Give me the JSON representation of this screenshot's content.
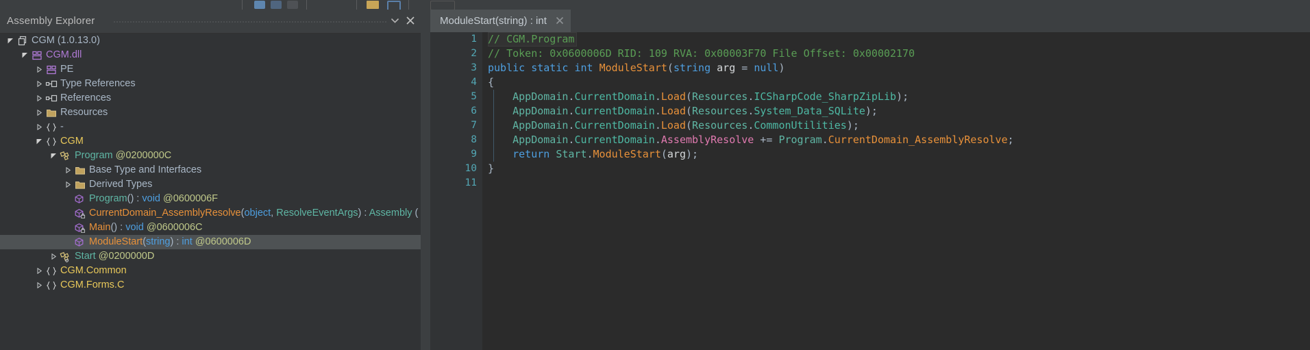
{
  "toolbar": {
    "separators": [
      353,
      447,
      555,
      640,
      700,
      760,
      820,
      900,
      1000
    ]
  },
  "panel": {
    "title": "Assembly Explorer",
    "chevron_icon": "chevron-down-icon",
    "close_icon": "close-icon"
  },
  "tree": [
    {
      "depth": 0,
      "twisty": "open",
      "icon": "assemblies-icon",
      "selected": false,
      "parts": [
        {
          "t": "CGM (1.0.13.0)",
          "c": "c-grayblue"
        }
      ]
    },
    {
      "depth": 1,
      "twisty": "open",
      "icon": "module-icon",
      "selected": false,
      "parts": [
        {
          "t": "CGM.dll",
          "c": "c-purpleTxt"
        }
      ]
    },
    {
      "depth": 2,
      "twisty": "closed",
      "icon": "module-icon",
      "selected": false,
      "parts": [
        {
          "t": "PE",
          "c": "c-grayblue"
        }
      ]
    },
    {
      "depth": 2,
      "twisty": "closed",
      "icon": "reference-icon",
      "selected": false,
      "parts": [
        {
          "t": "Type References",
          "c": "c-grayblue"
        }
      ]
    },
    {
      "depth": 2,
      "twisty": "closed",
      "icon": "reference-icon",
      "selected": false,
      "parts": [
        {
          "t": "References",
          "c": "c-grayblue"
        }
      ]
    },
    {
      "depth": 2,
      "twisty": "closed",
      "icon": "folder-icon",
      "selected": false,
      "parts": [
        {
          "t": "Resources",
          "c": "c-grayblue"
        }
      ]
    },
    {
      "depth": 2,
      "twisty": "closed",
      "icon": "namespace-icon",
      "selected": false,
      "parts": [
        {
          "t": "-",
          "c": "c-grayblue"
        }
      ]
    },
    {
      "depth": 2,
      "twisty": "open",
      "icon": "namespace-icon",
      "selected": false,
      "parts": [
        {
          "t": "CGM",
          "c": "c-yellow"
        }
      ]
    },
    {
      "depth": 3,
      "twisty": "open",
      "icon": "class-icon",
      "selected": false,
      "parts": [
        {
          "t": "Program",
          "c": "c-teal"
        },
        {
          "t": " ",
          "c": "c-grayblue"
        },
        {
          "t": "@0200000C",
          "c": "c-olive"
        }
      ]
    },
    {
      "depth": 4,
      "twisty": "closed",
      "icon": "folder-icon",
      "selected": false,
      "parts": [
        {
          "t": "Base Type and Interfaces",
          "c": "c-grayblue"
        }
      ]
    },
    {
      "depth": 4,
      "twisty": "closed",
      "icon": "folder-icon",
      "selected": false,
      "parts": [
        {
          "t": "Derived Types",
          "c": "c-grayblue"
        }
      ]
    },
    {
      "depth": 4,
      "twisty": "none",
      "icon": "method-icon",
      "selected": false,
      "parts": [
        {
          "t": "Program",
          "c": "c-teal"
        },
        {
          "t": "()",
          "c": "c-grayblue"
        },
        {
          "t": " : ",
          "c": "c-grayblue"
        },
        {
          "t": "void",
          "c": "c-blue"
        },
        {
          "t": " ",
          "c": "c-grayblue"
        },
        {
          "t": "@0600006F",
          "c": "c-olive"
        }
      ]
    },
    {
      "depth": 4,
      "twisty": "none",
      "icon": "method-private-icon",
      "selected": false,
      "parts": [
        {
          "t": "CurrentDomain_AssemblyResolve",
          "c": "c-orange"
        },
        {
          "t": "(",
          "c": "c-grayblue"
        },
        {
          "t": "object",
          "c": "c-blue"
        },
        {
          "t": ", ",
          "c": "c-grayblue"
        },
        {
          "t": "ResolveEventArgs",
          "c": "c-teal"
        },
        {
          "t": ") : ",
          "c": "c-grayblue"
        },
        {
          "t": "Assembly",
          "c": "c-teal"
        },
        {
          "t": " (",
          "c": "c-grayblue"
        }
      ]
    },
    {
      "depth": 4,
      "twisty": "none",
      "icon": "method-private-icon",
      "selected": false,
      "parts": [
        {
          "t": "Main",
          "c": "c-orange"
        },
        {
          "t": "()",
          "c": "c-grayblue"
        },
        {
          "t": " : ",
          "c": "c-grayblue"
        },
        {
          "t": "void",
          "c": "c-blue"
        },
        {
          "t": " ",
          "c": "c-grayblue"
        },
        {
          "t": "@0600006C",
          "c": "c-olive"
        }
      ]
    },
    {
      "depth": 4,
      "twisty": "none",
      "icon": "method-icon",
      "selected": true,
      "parts": [
        {
          "t": "ModuleStart",
          "c": "c-orange"
        },
        {
          "t": "(",
          "c": "c-grayblue"
        },
        {
          "t": "string",
          "c": "c-blue"
        },
        {
          "t": ") : ",
          "c": "c-grayblue"
        },
        {
          "t": "int",
          "c": "c-blue"
        },
        {
          "t": " ",
          "c": "c-grayblue"
        },
        {
          "t": "@0600006D",
          "c": "c-olive"
        }
      ]
    },
    {
      "depth": 3,
      "twisty": "closed",
      "icon": "class-internal-icon",
      "selected": false,
      "parts": [
        {
          "t": "Start",
          "c": "c-teal"
        },
        {
          "t": " ",
          "c": "c-grayblue"
        },
        {
          "t": "@0200000D",
          "c": "c-olive"
        }
      ]
    },
    {
      "depth": 2,
      "twisty": "closed",
      "icon": "namespace-icon",
      "selected": false,
      "parts": [
        {
          "t": "CGM.Common",
          "c": "c-yellow"
        }
      ]
    },
    {
      "depth": 2,
      "twisty": "closed",
      "icon": "namespace-icon",
      "selected": false,
      "parts": [
        {
          "t": "CGM.Forms.C",
          "c": "c-yellow"
        }
      ]
    }
  ],
  "editor": {
    "tab": {
      "label": "ModuleStart(string) : int",
      "close_icon": "close-icon"
    },
    "lines": [
      {
        "n": "1",
        "current": true,
        "guide": false,
        "parts": [
          {
            "t": "// CGM.Program",
            "c": "c-green"
          }
        ]
      },
      {
        "n": "2",
        "current": false,
        "guide": false,
        "parts": [
          {
            "t": "// Token: 0x0600006D RID: 109 RVA: 0x00003F70 File Offset: 0x00002170",
            "c": "c-green"
          }
        ]
      },
      {
        "n": "3",
        "current": false,
        "guide": false,
        "parts": [
          {
            "t": "public",
            "c": "c-blue"
          },
          {
            "t": " ",
            "c": "c-grayblue"
          },
          {
            "t": "static",
            "c": "c-blue"
          },
          {
            "t": " ",
            "c": "c-grayblue"
          },
          {
            "t": "int",
            "c": "c-blue"
          },
          {
            "t": " ",
            "c": "c-grayblue"
          },
          {
            "t": "ModuleStart",
            "c": "c-orange"
          },
          {
            "t": "(",
            "c": "c-grayblue"
          },
          {
            "t": "string",
            "c": "c-blue"
          },
          {
            "t": " ",
            "c": "c-grayblue"
          },
          {
            "t": "arg",
            "c": "c-white"
          },
          {
            "t": " = ",
            "c": "c-grayblue"
          },
          {
            "t": "null",
            "c": "c-blue"
          },
          {
            "t": ")",
            "c": "c-grayblue"
          }
        ]
      },
      {
        "n": "4",
        "current": false,
        "guide": false,
        "parts": [
          {
            "t": "{",
            "c": "c-grayblue"
          }
        ]
      },
      {
        "n": "5",
        "current": false,
        "guide": true,
        "parts": [
          {
            "t": "    ",
            "c": "c-grayblue"
          },
          {
            "t": "AppDomain",
            "c": "c-teal"
          },
          {
            "t": ".",
            "c": "c-grayblue"
          },
          {
            "t": "CurrentDomain",
            "c": "c-tealdim"
          },
          {
            "t": ".",
            "c": "c-grayblue"
          },
          {
            "t": "Load",
            "c": "c-orange"
          },
          {
            "t": "(",
            "c": "c-grayblue"
          },
          {
            "t": "Resources",
            "c": "c-teal"
          },
          {
            "t": ".",
            "c": "c-grayblue"
          },
          {
            "t": "ICSharpCode_SharpZipLib",
            "c": "c-tealdim"
          },
          {
            "t": ");",
            "c": "c-grayblue"
          }
        ]
      },
      {
        "n": "6",
        "current": false,
        "guide": true,
        "parts": [
          {
            "t": "    ",
            "c": "c-grayblue"
          },
          {
            "t": "AppDomain",
            "c": "c-teal"
          },
          {
            "t": ".",
            "c": "c-grayblue"
          },
          {
            "t": "CurrentDomain",
            "c": "c-tealdim"
          },
          {
            "t": ".",
            "c": "c-grayblue"
          },
          {
            "t": "Load",
            "c": "c-orange"
          },
          {
            "t": "(",
            "c": "c-grayblue"
          },
          {
            "t": "Resources",
            "c": "c-teal"
          },
          {
            "t": ".",
            "c": "c-grayblue"
          },
          {
            "t": "System_Data_SQLite",
            "c": "c-tealdim"
          },
          {
            "t": ");",
            "c": "c-grayblue"
          }
        ]
      },
      {
        "n": "7",
        "current": false,
        "guide": true,
        "parts": [
          {
            "t": "    ",
            "c": "c-grayblue"
          },
          {
            "t": "AppDomain",
            "c": "c-teal"
          },
          {
            "t": ".",
            "c": "c-grayblue"
          },
          {
            "t": "CurrentDomain",
            "c": "c-tealdim"
          },
          {
            "t": ".",
            "c": "c-grayblue"
          },
          {
            "t": "Load",
            "c": "c-orange"
          },
          {
            "t": "(",
            "c": "c-grayblue"
          },
          {
            "t": "Resources",
            "c": "c-teal"
          },
          {
            "t": ".",
            "c": "c-grayblue"
          },
          {
            "t": "CommonUtilities",
            "c": "c-tealdim"
          },
          {
            "t": ");",
            "c": "c-grayblue"
          }
        ]
      },
      {
        "n": "8",
        "current": false,
        "guide": true,
        "parts": [
          {
            "t": "    ",
            "c": "c-grayblue"
          },
          {
            "t": "AppDomain",
            "c": "c-teal"
          },
          {
            "t": ".",
            "c": "c-grayblue"
          },
          {
            "t": "CurrentDomain",
            "c": "c-tealdim"
          },
          {
            "t": ".",
            "c": "c-grayblue"
          },
          {
            "t": "AssemblyResolve",
            "c": "c-pink"
          },
          {
            "t": " += ",
            "c": "c-grayblue"
          },
          {
            "t": "Program",
            "c": "c-teal"
          },
          {
            "t": ".",
            "c": "c-grayblue"
          },
          {
            "t": "CurrentDomain_AssemblyResolve",
            "c": "c-orange"
          },
          {
            "t": ";",
            "c": "c-grayblue"
          }
        ]
      },
      {
        "n": "9",
        "current": false,
        "guide": true,
        "parts": [
          {
            "t": "    ",
            "c": "c-grayblue"
          },
          {
            "t": "return",
            "c": "c-blue"
          },
          {
            "t": " ",
            "c": "c-grayblue"
          },
          {
            "t": "Start",
            "c": "c-teal"
          },
          {
            "t": ".",
            "c": "c-grayblue"
          },
          {
            "t": "ModuleStart",
            "c": "c-orange"
          },
          {
            "t": "(",
            "c": "c-grayblue"
          },
          {
            "t": "arg",
            "c": "c-white"
          },
          {
            "t": ");",
            "c": "c-grayblue"
          }
        ]
      },
      {
        "n": "10",
        "current": false,
        "guide": false,
        "parts": [
          {
            "t": "}",
            "c": "c-grayblue"
          }
        ]
      },
      {
        "n": "11",
        "current": false,
        "guide": false,
        "parts": []
      }
    ]
  },
  "colors": {
    "panel_bg": "#3c3f41",
    "tree_bg": "#313335",
    "editor_bg": "#2b2b2b",
    "selection": "#4e5254",
    "line_number": "#53a8b5",
    "comment": "#5a9e55"
  }
}
